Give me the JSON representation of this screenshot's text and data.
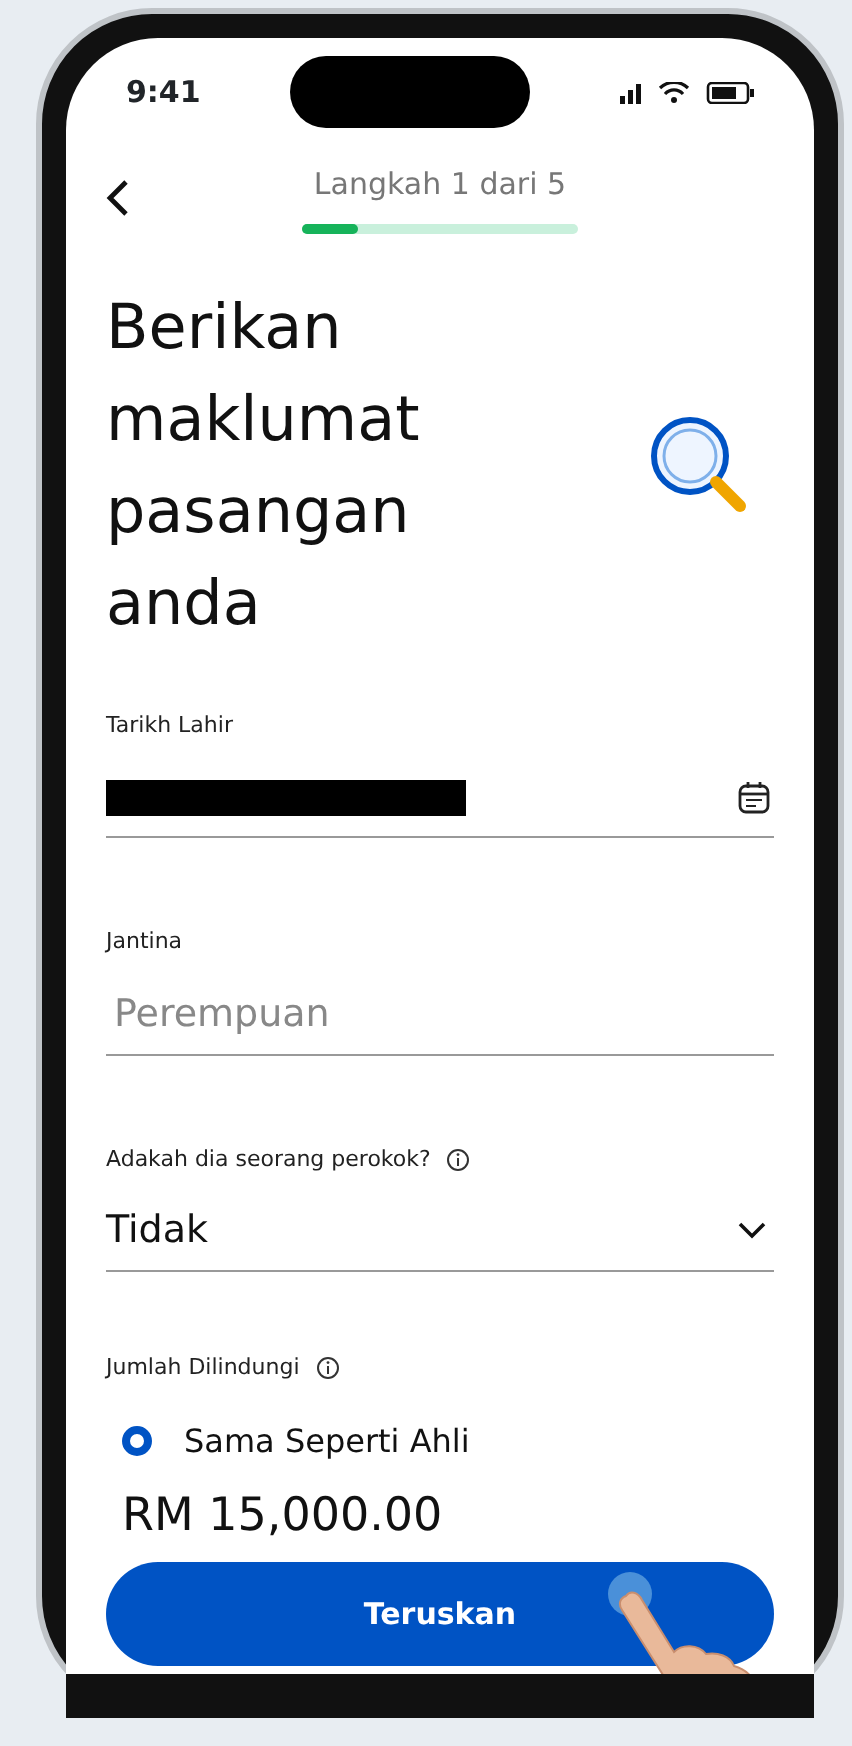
{
  "status_bar": {
    "time": "9:41"
  },
  "header": {
    "step_text": "Langkah 1 dari 5",
    "progress": {
      "level": 0.2
    }
  },
  "title": "Berikan maklumat pasangan anda",
  "fields": [
    {
      "kind": "date",
      "label": "Tarikh Lahir",
      "info": false
    },
    {
      "kind": "text",
      "label": "Jantina",
      "placeholder": "Perempuan",
      "info": false
    },
    {
      "kind": "select",
      "label": "Adakah dia seorang perokok?",
      "value": "Tidak",
      "info": true
    }
  ],
  "coverage": {
    "label": "Jumlah Dilindungi",
    "info": true,
    "options": [
      {
        "label": "Sama Seperti Ahli",
        "selected": true
      }
    ],
    "amount": "RM 15,000.00"
  },
  "continue_button": "Teruskan"
}
